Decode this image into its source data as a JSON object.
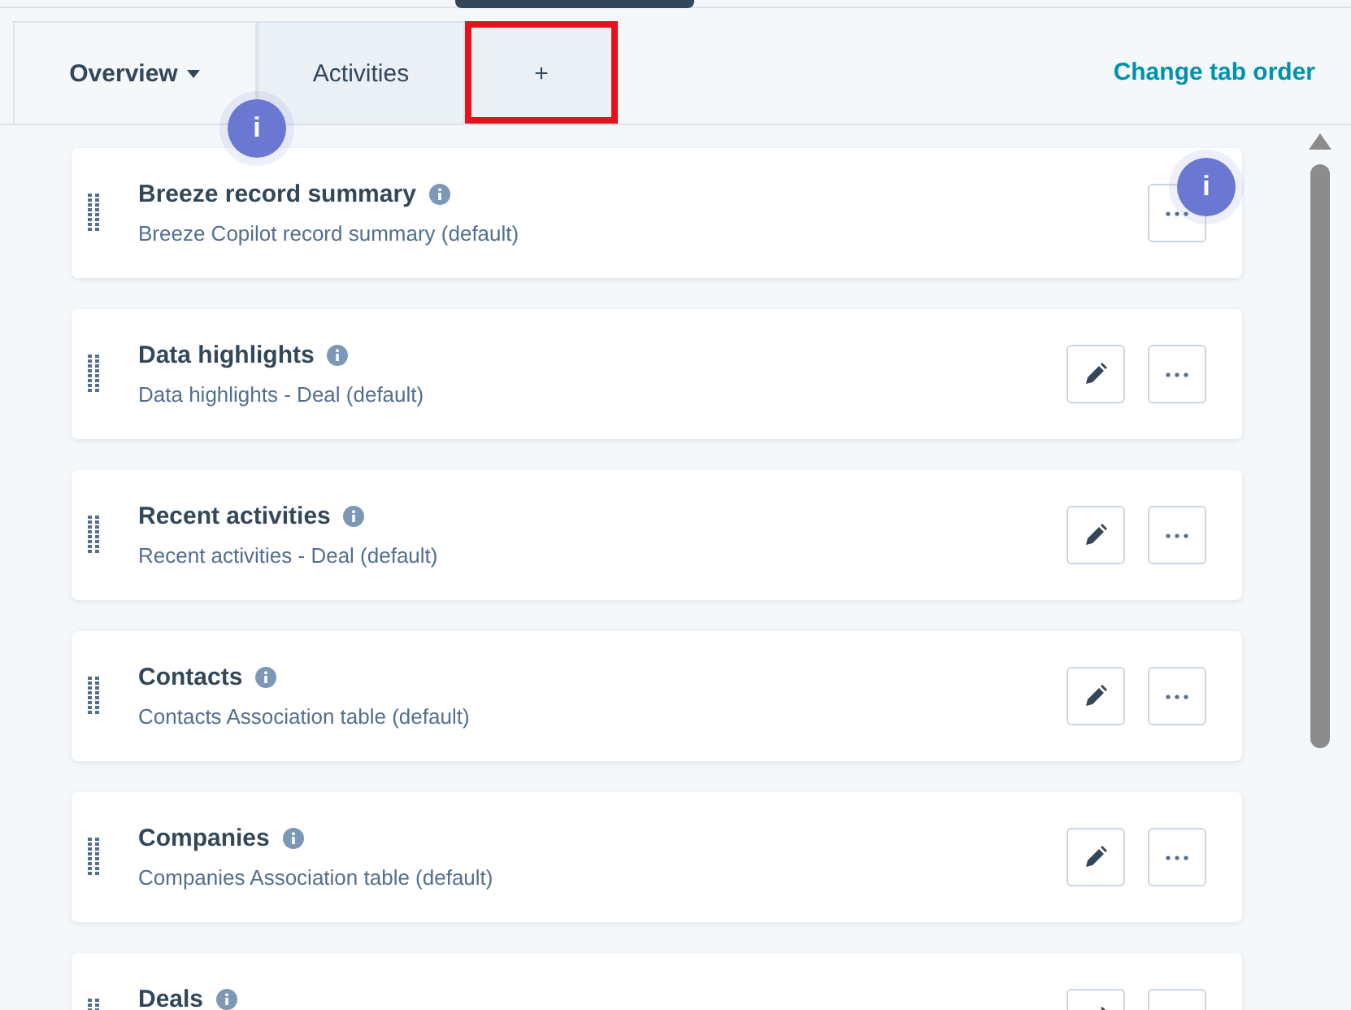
{
  "tabs": [
    {
      "label": "Overview",
      "selected": true,
      "has_caret": true,
      "highlighted": false,
      "badge": "i"
    },
    {
      "label": "Activities",
      "selected": false,
      "has_caret": false,
      "highlighted": false
    },
    {
      "label": "+",
      "selected": false,
      "has_caret": false,
      "highlighted": true
    }
  ],
  "change_tab_order_link": "Change tab order",
  "cards": [
    {
      "title": "Breeze record summary",
      "subtitle": "Breeze Copilot record summary (default)",
      "editable": false,
      "badge": "i"
    },
    {
      "title": "Data highlights",
      "subtitle": "Data highlights - Deal (default)",
      "editable": true
    },
    {
      "title": "Recent activities",
      "subtitle": "Recent activities - Deal (default)",
      "editable": true
    },
    {
      "title": "Contacts",
      "subtitle": "Contacts Association table (default)",
      "editable": true
    },
    {
      "title": "Companies",
      "subtitle": "Companies Association table (default)",
      "editable": true
    },
    {
      "title": "Deals",
      "editable": true
    }
  ]
}
